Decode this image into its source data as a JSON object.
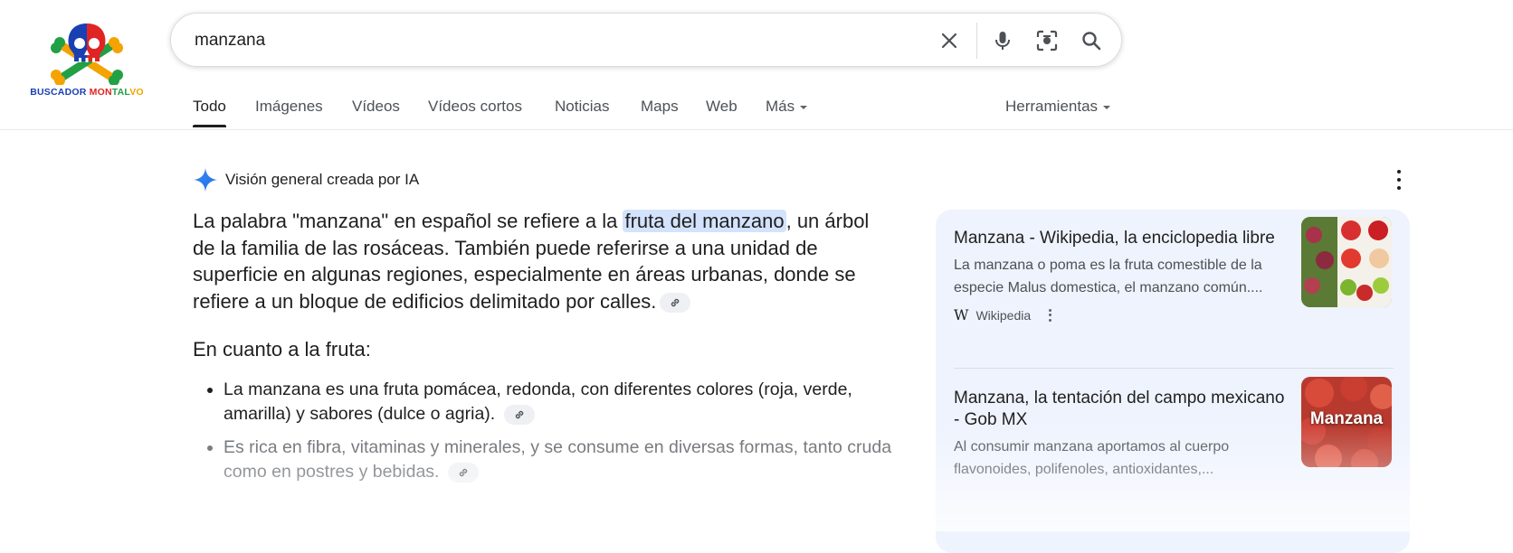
{
  "brand": {
    "logo_text": "BUSCADOR MONTALVO"
  },
  "search": {
    "query": "manzana"
  },
  "icons": {
    "clear": "close-icon",
    "voice": "mic-icon",
    "lens": "camera-search-icon",
    "search": "search-icon",
    "ai": "sparkle-icon"
  },
  "tabs": [
    {
      "label": "Todo",
      "active": true
    },
    {
      "label": "Imágenes"
    },
    {
      "label": "Vídeos"
    },
    {
      "label": "Vídeos cortos"
    },
    {
      "label": "Noticias"
    },
    {
      "label": "Maps"
    },
    {
      "label": "Web"
    },
    {
      "label": "Más"
    }
  ],
  "tools": {
    "label": "Herramientas"
  },
  "ai_overview": {
    "heading": "Visión general creada por IA",
    "para_before": "La palabra \"manzana\" en español se refiere a la ",
    "highlight": "fruta del manzano",
    "para_after": ", un árbol de la familia de las rosáceas. También puede referirse a una unidad de superficie en algunas regiones, especialmente en áreas urbanas, donde se refiere a un bloque de edificios delimitado por calles.",
    "subheading": "En cuanto a la fruta:",
    "bullets": [
      "La manzana es una fruta pomácea, redonda, con diferentes colores (roja, verde, amarilla) y sabores (dulce o agria).",
      "Es rica en fibra, vitaminas y minerales, y se consume en diversas formas, tanto cruda como en postres y bebidas."
    ]
  },
  "sources": [
    {
      "title": "Manzana - Wikipedia, la enciclopedia libre",
      "description": "La manzana o poma es la fruta comestible de la especie Malus domestica, el manzano común....",
      "site": "Wikipedia",
      "site_icon": "W"
    },
    {
      "title": "Manzana, la tentación del campo mexicano - Gob MX",
      "description": "Al consumir manzana aportamos al cuerpo flavonoides, polifenoles, antioxidantes,...",
      "thumb_label": "Manzana"
    }
  ],
  "colors": {
    "accent": "#1a73e8",
    "highlight": "#d3e3fd",
    "panel": "#eef3fd",
    "logo_blue": "#1a3fb3",
    "logo_red": "#e02424"
  }
}
